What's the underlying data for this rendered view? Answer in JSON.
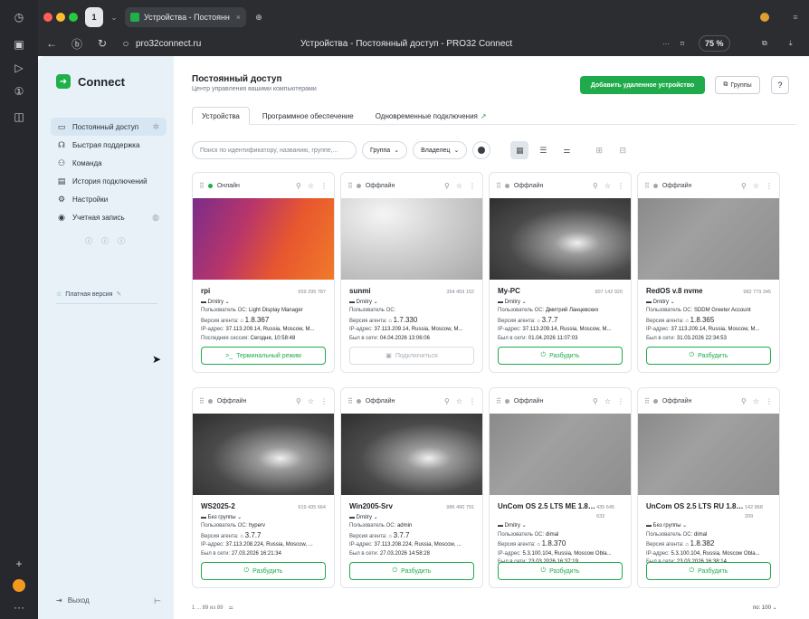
{
  "browser": {
    "tab_count": "1",
    "tab_title": "Устройства - Постоянн",
    "url": "pro32connect.ru",
    "page_title": "Устройства - Постоянный доступ - PRO32 Connect",
    "zoom": "75 %"
  },
  "sidebar": {
    "logo": "Connect",
    "items": [
      {
        "label": "Постоянный доступ",
        "icon": "monitor-icon"
      },
      {
        "label": "Быстрая поддержка",
        "icon": "headset-icon"
      },
      {
        "label": "Команда",
        "icon": "team-icon"
      },
      {
        "label": "История подключений",
        "icon": "history-icon"
      },
      {
        "label": "Настройки",
        "icon": "gear-icon"
      },
      {
        "label": "Учетная запись",
        "icon": "account-icon"
      }
    ],
    "paid": "Платная версия",
    "logout": "Выход"
  },
  "header": {
    "title": "Постоянный доступ",
    "subtitle": "Центр управления вашими компьютерами",
    "add_button": "Добавить удаленное устройство",
    "groups_button": "Группы"
  },
  "tabs": [
    "Устройства",
    "Программное обеспечение",
    "Одновременные подключения"
  ],
  "toolbar": {
    "search_placeholder": "Поиск по идентификатору, названию, группе,...",
    "group": "Группа",
    "owner": "Владелец"
  },
  "labels": {
    "os_user": "Пользователь ОС:",
    "agent": "Версия агента:",
    "ip": "IP-адрес:",
    "last_session": "Последняя сессия:",
    "online_at": "Был в сети:"
  },
  "devices": [
    {
      "status": "Онлайн",
      "name": "rpi",
      "id": "659 295 787",
      "owner": "Dmitry",
      "os_user": "Light Display Manager",
      "agent": "1.8.367",
      "ip": "37.113.209.14, Russia, Moscow, M...",
      "time_label": "Последняя сессия:",
      "time": "Сегодня, 10:58:48",
      "button": "Терминальный режим",
      "img": "orange"
    },
    {
      "status": "Оффлайн",
      "name": "sunmi",
      "id": "354 459 152",
      "owner": "Dmitry",
      "os_user": "",
      "agent": "1.7.330",
      "ip": "37.113.209.14, Russia, Moscow, M...",
      "time_label": "Был в сети:",
      "time": "04.04.2026 13:06:06",
      "button": "Подключиться",
      "img": "android"
    },
    {
      "status": "Оффлайн",
      "name": "My-PC",
      "id": "907 142 920",
      "owner": "Dmitry",
      "os_user": "Дмитрий Ланцевских",
      "agent": "3.7.7",
      "ip": "37.113.209.14, Russia, Moscow, M...",
      "time_label": "Был в сети:",
      "time": "01.04.2026 11:07:03",
      "button": "Разбудить",
      "img": "windows"
    },
    {
      "status": "Оффлайн",
      "name": "RedOS v.8 nvme",
      "id": "982 779 345",
      "owner": "Dmitry",
      "os_user": "SDDM Greeter Account",
      "agent": "1.8.365",
      "ip": "37.113.209.14, Russia, Moscow, M...",
      "time_label": "Был в сети:",
      "time": "31.03.2026 22:34:53",
      "button": "Разбудить",
      "img": "gray"
    },
    {
      "status": "Оффлайн",
      "name": "WS2025-2",
      "id": "619 435 664",
      "owner": "Без группы",
      "os_user": "hyperv",
      "agent": "3.7.7",
      "ip": "37.113.208.224, Russia, Moscow, ...",
      "time_label": "Был в сети:",
      "time": "27.03.2026 16:21:34",
      "button": "Разбудить",
      "img": "windows"
    },
    {
      "status": "Оффлайн",
      "name": "Win2005-Srv",
      "id": "986 490 791",
      "owner": "Dmitry",
      "os_user": "admin",
      "agent": "3.7.7",
      "ip": "37.113.208.224, Russia, Moscow, ...",
      "time_label": "Был в сети:",
      "time": "27.03.2026 14:58:28",
      "button": "Разбудить",
      "img": "windows"
    },
    {
      "status": "Оффлайн",
      "name": "UnCom OS 2.5 LTS ME 1.8.370",
      "id": "435 645 632",
      "owner": "Dmitry",
      "os_user": "dimal",
      "agent": "1.8.370",
      "ip": "5.3.100.104, Russia, Moscow Obla...",
      "time_label": "Был в сети:",
      "time": "23.03.2026 16:37:19",
      "button": "Разбудить",
      "img": "gray"
    },
    {
      "status": "Оффлайн",
      "name": "UnCom OS 2.5 LTS RU 1.8.382",
      "id": "142 868 209",
      "owner": "Без группы",
      "os_user": "dimal",
      "agent": "1.8.382",
      "ip": "5.3.100.104, Russia, Moscow Obla...",
      "time_label": "Был в сети:",
      "time": "23.03.2026 16:38:14",
      "button": "Разбудить",
      "img": "gray"
    }
  ],
  "footer": {
    "range": "1 ... 89 из 89",
    "per_page": "по: 100"
  },
  "colors": {
    "accent": "#1faa4b",
    "sidebar": "#e8f1f8"
  }
}
